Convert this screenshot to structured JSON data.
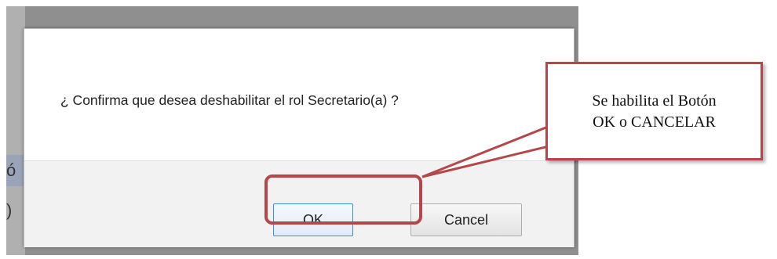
{
  "dialog": {
    "message": "¿ Confirma que desea deshabilitar el rol Secretario(a) ?",
    "ok_label": "OK",
    "cancel_label": "Cancel"
  },
  "background": {
    "fragment_1": "ó",
    "fragment_2": ")"
  },
  "annotation": {
    "line1": "Se habilita el Botón",
    "line2": "OK o CANCELAR",
    "color": "#b5474b"
  }
}
